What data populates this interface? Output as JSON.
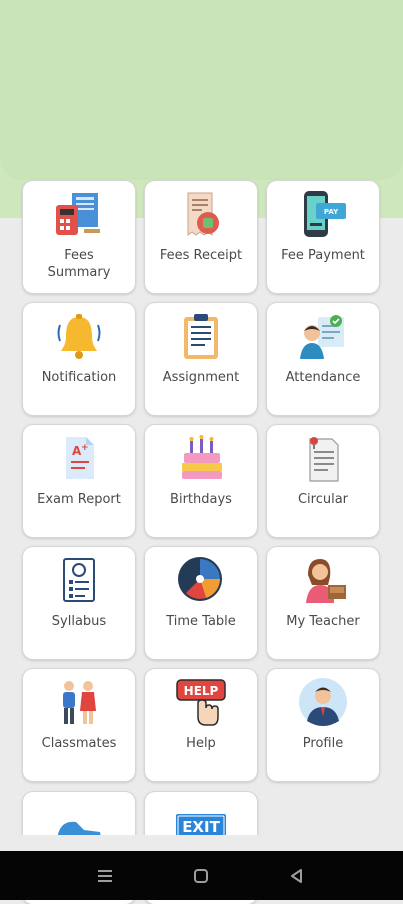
{
  "tiles": [
    {
      "label": "Fees\nSummary",
      "icon": "fees-summary-icon"
    },
    {
      "label": "Fees Receipt",
      "icon": "fees-receipt-icon"
    },
    {
      "label": "Fee Payment",
      "icon": "fee-payment-icon"
    },
    {
      "label": "Notification",
      "icon": "bell-icon"
    },
    {
      "label": "Assignment",
      "icon": "clipboard-icon"
    },
    {
      "label": "Attendance",
      "icon": "attendance-icon"
    },
    {
      "label": "Exam Report",
      "icon": "exam-report-icon"
    },
    {
      "label": "Birthdays",
      "icon": "cake-icon"
    },
    {
      "label": "Circular",
      "icon": "circular-icon"
    },
    {
      "label": "Syllabus",
      "icon": "syllabus-icon"
    },
    {
      "label": "Time Table",
      "icon": "time-table-icon"
    },
    {
      "label": "My Teacher",
      "icon": "teacher-icon"
    },
    {
      "label": "Classmates",
      "icon": "classmates-icon"
    },
    {
      "label": "Help",
      "icon": "help-icon"
    },
    {
      "label": "Profile",
      "icon": "profile-icon"
    },
    {
      "label": "",
      "icon": "shoe-icon"
    },
    {
      "label": "",
      "icon": "exit-icon"
    }
  ],
  "help_sign": "HELP",
  "exit_sign": "EXIT",
  "pay_sign": "PAY",
  "nav": {
    "recents": "recents-icon",
    "home": "home-icon",
    "back": "back-icon"
  }
}
